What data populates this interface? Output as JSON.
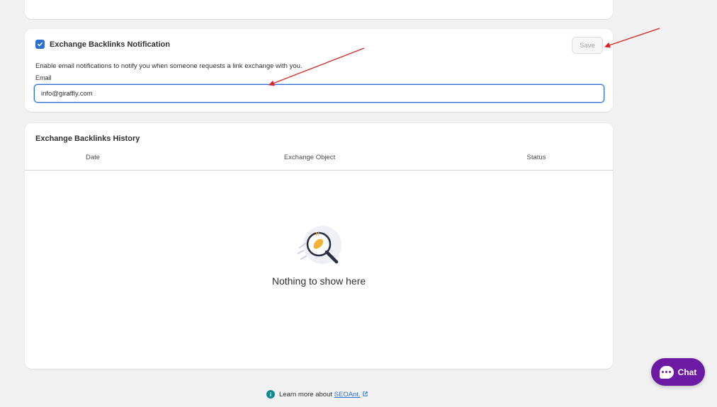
{
  "notification": {
    "checkbox_checked": true,
    "title": "Exchange Backlinks Notification",
    "save_label": "Save",
    "description": "Enable email notifications to notify you when someone requests a link exchange with you.",
    "email_label": "Email",
    "email_value": "info@giraffly.com"
  },
  "history": {
    "title": "Exchange Backlinks History",
    "columns": [
      "Date",
      "Exchange Object",
      "Status"
    ],
    "rows": [],
    "empty_text": "Nothing to show here"
  },
  "footer": {
    "learn_more_prefix": "Learn more about ",
    "learn_more_link": "SEOAnt.",
    "info_icon": "info-icon",
    "external_icon": "external-link-icon"
  },
  "chat": {
    "label": "Chat",
    "icon": "chat-bubble-icon",
    "color": "#6c1aa3"
  },
  "colors": {
    "accent": "#2c6ecb",
    "annotation_arrow": "#e02020"
  }
}
